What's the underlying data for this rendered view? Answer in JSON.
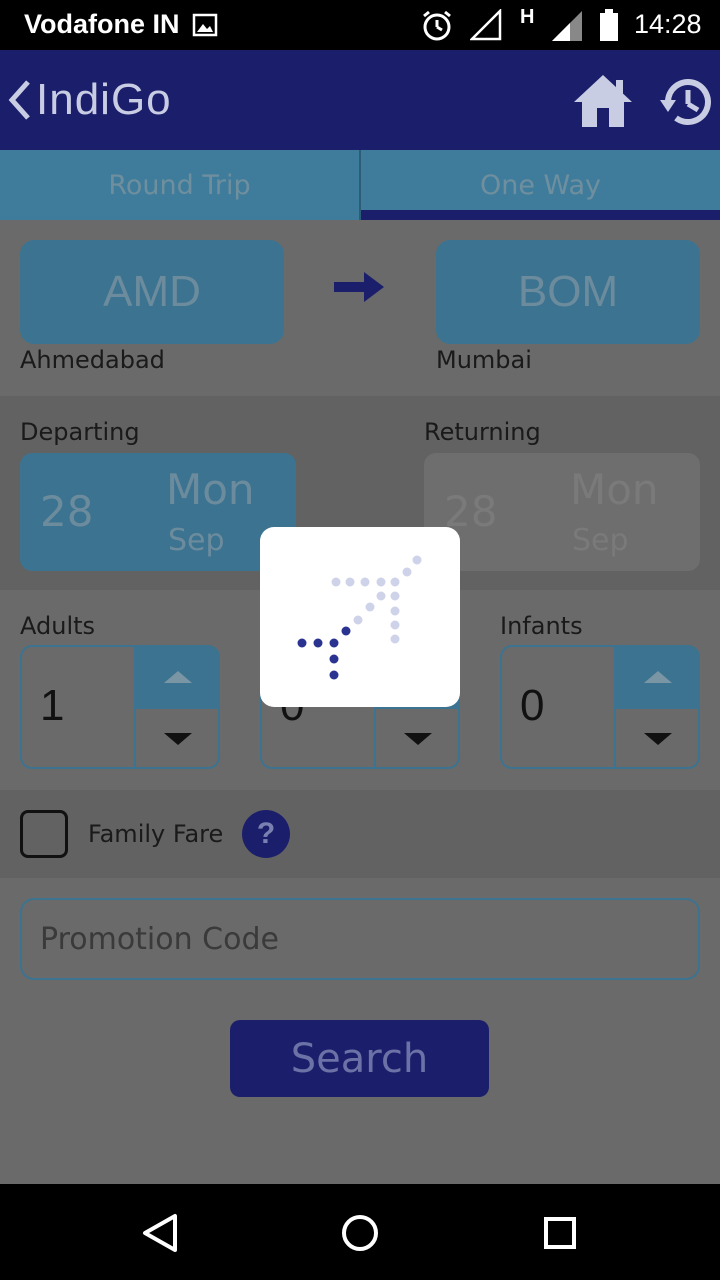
{
  "status_bar": {
    "carrier": "Vodafone IN",
    "network_type": "H",
    "time": "14:28",
    "icons": [
      "image-icon",
      "alarm-icon",
      "signal-empty-icon",
      "signal-icon",
      "battery-icon"
    ]
  },
  "header": {
    "title": "IndiGo",
    "back_icon": "chevron-left-icon",
    "home_icon": "home-icon",
    "history_icon": "history-icon"
  },
  "tabs": [
    {
      "label": "Round Trip",
      "selected": false
    },
    {
      "label": "One Way",
      "selected": true
    }
  ],
  "route": {
    "from_code": "AMD",
    "from_city": "Ahmedabad",
    "to_code": "BOM",
    "to_city": "Mumbai"
  },
  "dates": {
    "departing_label": "Departing",
    "departing": {
      "day": "28",
      "weekday": "Mon",
      "month": "Sep"
    },
    "returning_label": "Returning",
    "returning": {
      "day": "28",
      "weekday": "Mon",
      "month": "Sep"
    }
  },
  "passengers": {
    "adults_label": "Adults",
    "adults_value": "1",
    "children_value": "0",
    "infants_label": "Infants",
    "infants_value": "0"
  },
  "family_fare": {
    "label": "Family Fare",
    "checked": false,
    "help": "?"
  },
  "promo": {
    "placeholder": "Promotion Code"
  },
  "search": {
    "label": "Search"
  },
  "loading": {
    "icon": "indigo-logo-loading-icon"
  },
  "nav": {
    "icons": [
      "back-triangle-icon",
      "home-circle-icon",
      "recents-square-icon"
    ]
  },
  "colors": {
    "header": "#1b1f6b",
    "accent": "#3c7390",
    "overlay_bg": "#6a6a6a"
  }
}
